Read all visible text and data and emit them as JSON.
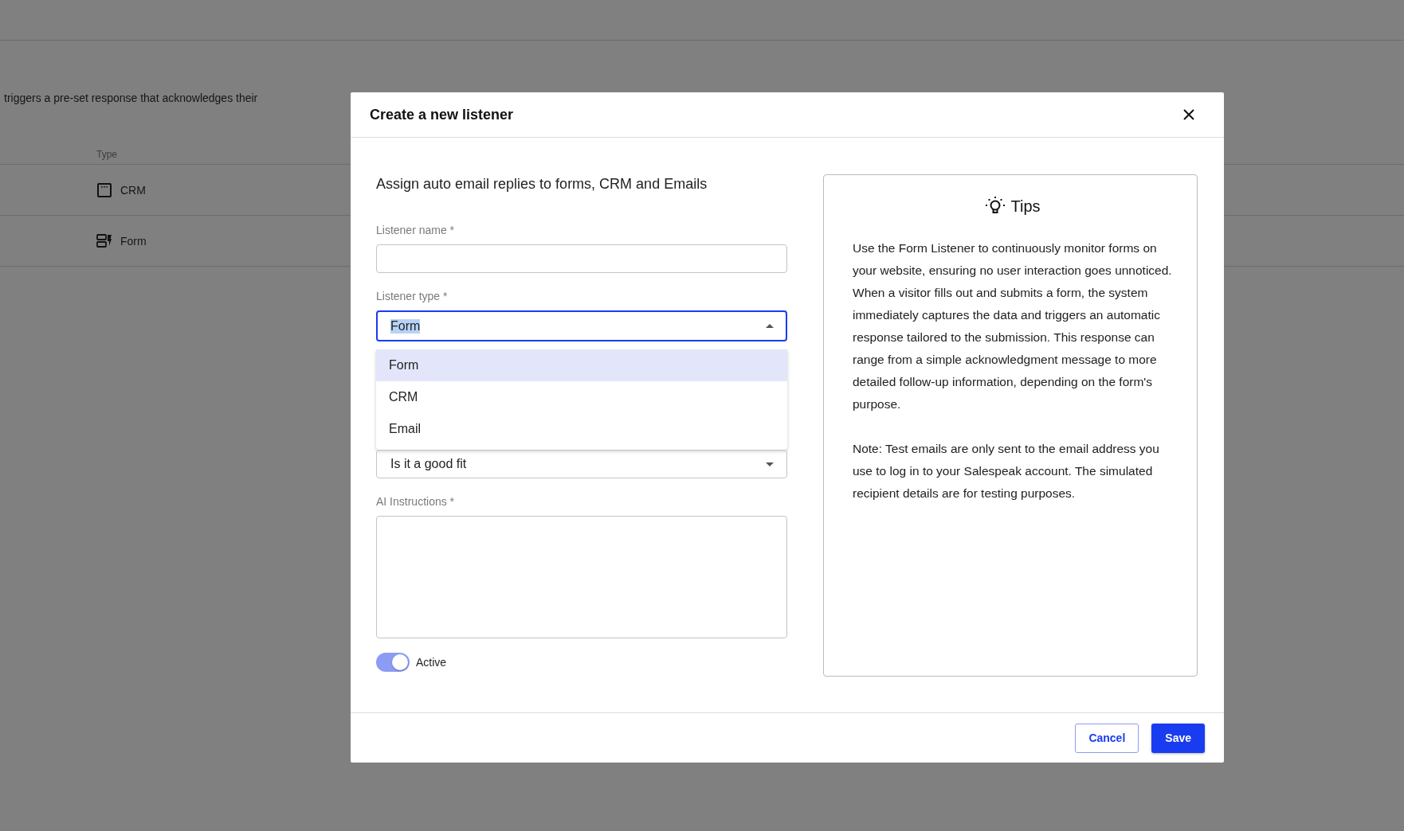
{
  "background": {
    "intro_text": "triggers a pre-set response that acknowledges their",
    "table": {
      "columns": [
        "Type"
      ],
      "rows": [
        {
          "kind": "crm",
          "type": "CRM"
        },
        {
          "kind": "form",
          "type": "Form"
        }
      ]
    }
  },
  "dialog": {
    "title": "Create a new listener",
    "subtitle": "Assign auto email replies to forms, CRM and Emails",
    "fields": [
      {
        "kind": "text",
        "label": "Listener name *"
      },
      {
        "kind": "select",
        "label": "Listener type *",
        "value": "Form",
        "expanded": true,
        "options": [
          {
            "label": "Form",
            "selected": true
          },
          {
            "label": "CRM",
            "selected": false
          },
          {
            "label": "Email",
            "selected": false
          }
        ]
      },
      {
        "kind": "select",
        "value": "Is it a good fit",
        "expanded": false
      },
      {
        "kind": "textarea",
        "label": "AI Instructions *"
      },
      {
        "kind": "toggle",
        "label": "Active",
        "on": true
      }
    ],
    "tips": {
      "title": "Tips",
      "paragraphs": [
        "Use the Form Listener to continuously monitor forms on your website, ensuring no user interaction goes unnoticed. When a visitor fills out and submits a form, the system immediately captures the data and triggers an automatic response tailored to the submission. This response can range from a simple acknowledgment message to more detailed follow-up information, depending on the form's purpose.",
        "Note: Test emails are only sent to the email address you use to log in to your Salespeak account. The simulated recipient details are for testing purposes."
      ]
    },
    "buttons": [
      {
        "kind": "secondary",
        "label": "Cancel"
      },
      {
        "kind": "primary",
        "label": "Save"
      }
    ]
  }
}
